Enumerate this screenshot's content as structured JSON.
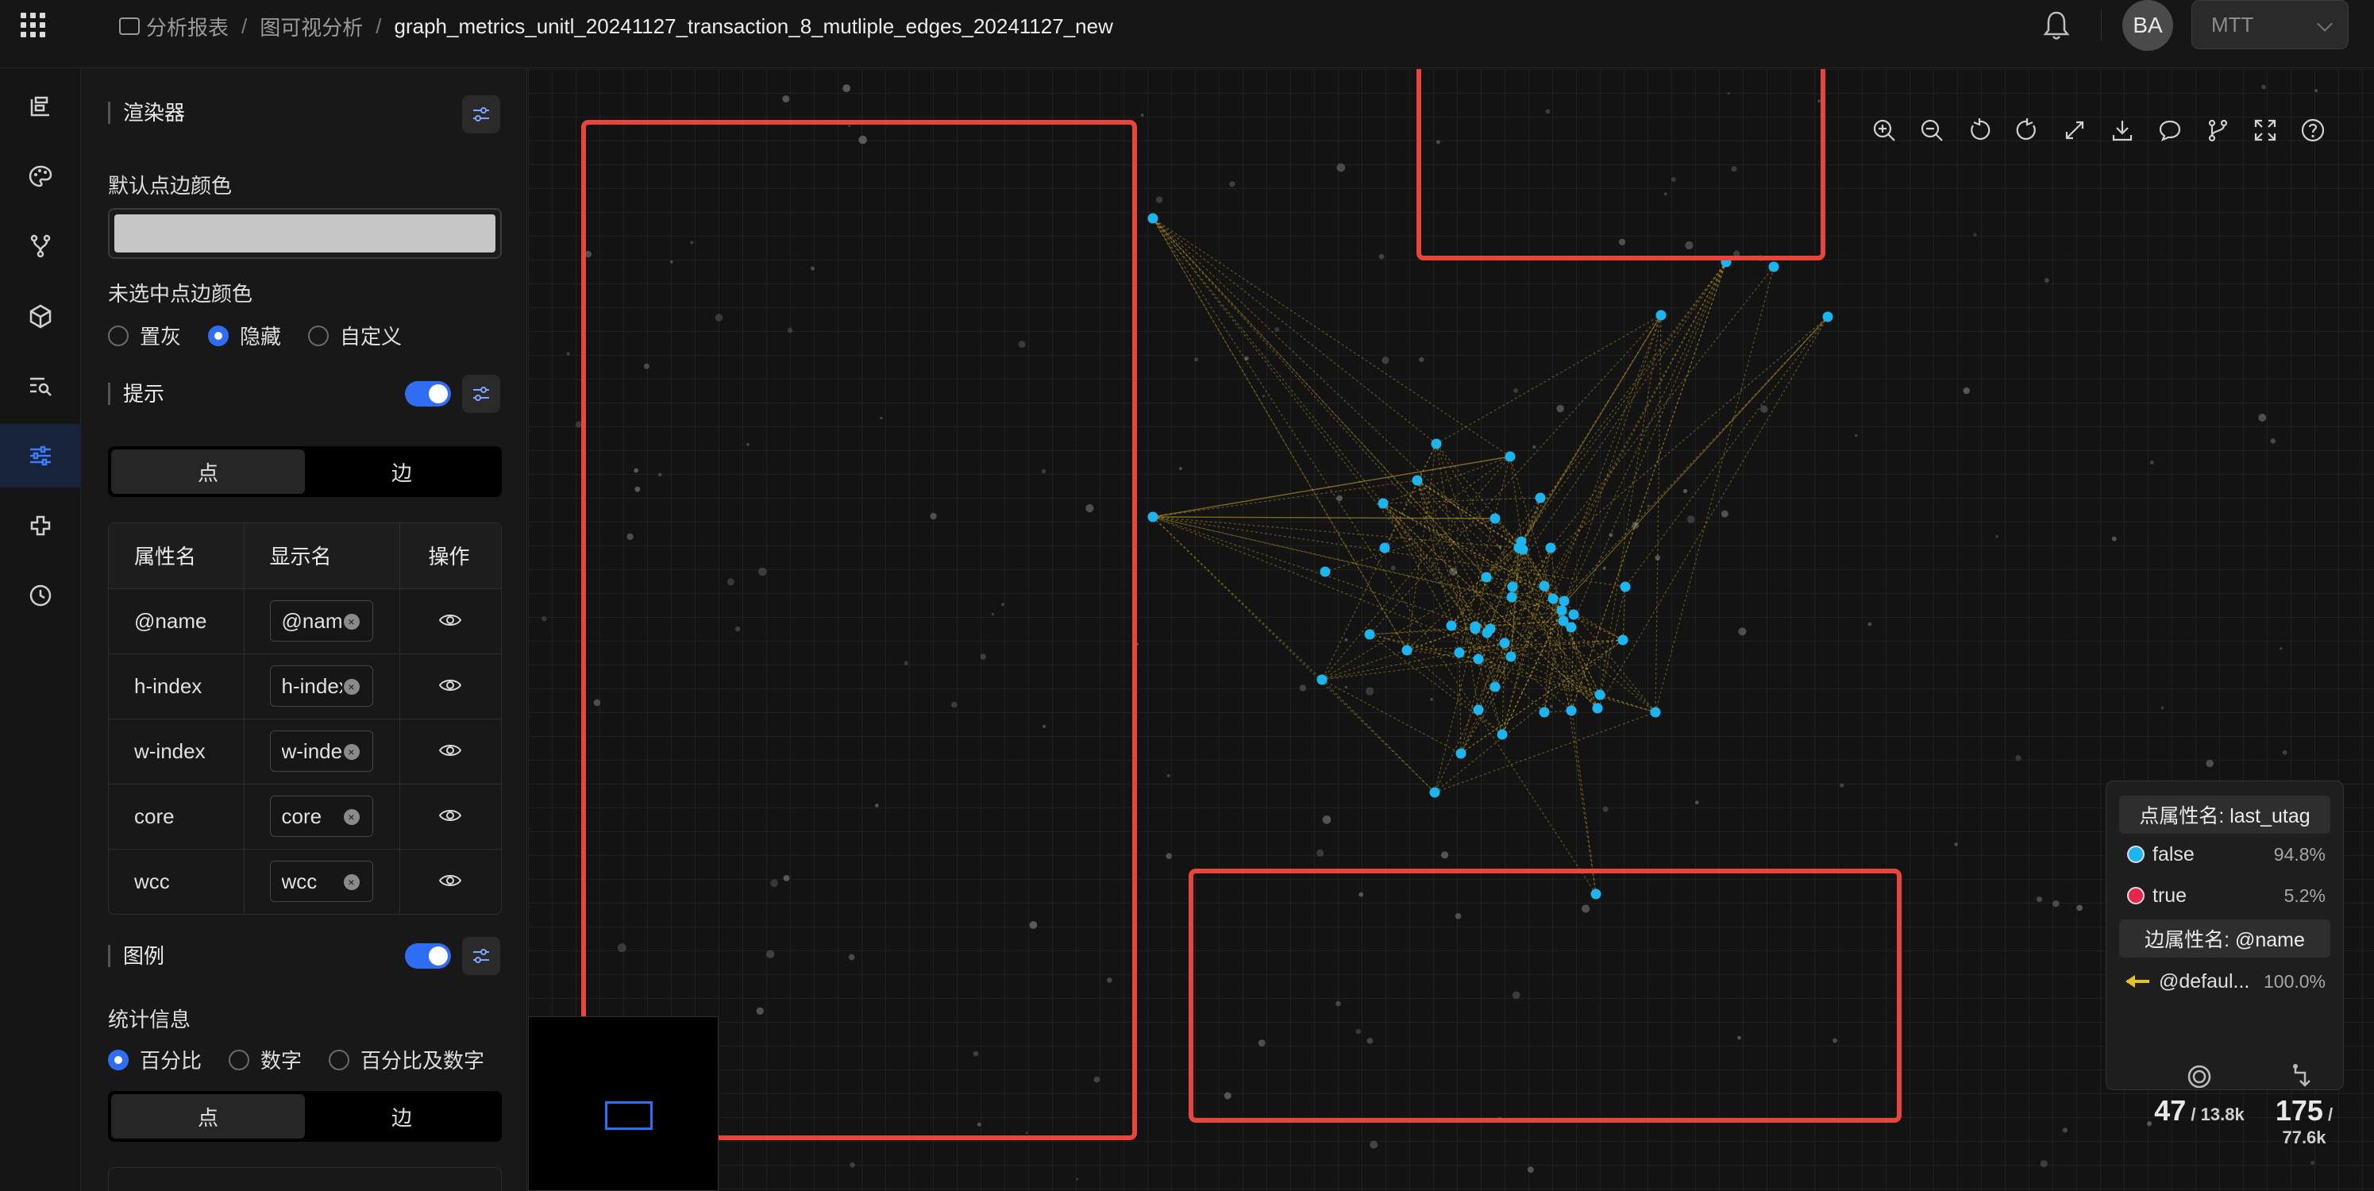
{
  "breadcrumb": {
    "items": [
      "分析报表",
      "图可视分析"
    ],
    "current": "graph_metrics_unitl_20241127_transaction_8_mutliple_edges_20241127_new"
  },
  "header": {
    "avatar": "BA",
    "project": "MTT"
  },
  "rail": {
    "icons": [
      "layers-icon",
      "palette-icon",
      "branch-icon",
      "cube-icon",
      "search-list-icon",
      "sliders-icon",
      "plugin-icon",
      "history-icon"
    ],
    "active_index": 5
  },
  "renderer": {
    "title": "渲染器",
    "default_node_border_label": "默认点边颜色",
    "default_node_border_color": "#c6c6c6",
    "unselected_border_label": "未选中点边颜色",
    "unselected_options": [
      "置灰",
      "隐藏",
      "自定义"
    ],
    "unselected_selected": 1
  },
  "tooltip": {
    "title": "提示",
    "enabled": true,
    "tabs": [
      "点",
      "边"
    ],
    "columns": [
      "属性名",
      "显示名",
      "操作"
    ],
    "rows": [
      {
        "name": "@name",
        "display": "@name"
      },
      {
        "name": "h-index",
        "display": "h-index"
      },
      {
        "name": "w-index",
        "display": "w-index"
      },
      {
        "name": "core",
        "display": "core"
      },
      {
        "name": "wcc",
        "display": "wcc"
      }
    ]
  },
  "legend_settings": {
    "title": "图例",
    "enabled": true,
    "stats_label": "统计信息",
    "stats_options": [
      "百分比",
      "数字",
      "百分比及数字"
    ],
    "stats_selected": 0,
    "tabs": [
      "点",
      "边"
    ]
  },
  "legend": {
    "node_header": "点属性名: last_utag",
    "node_items": [
      {
        "label": "false",
        "pct": "94.8%",
        "color": "#1cb5f0"
      },
      {
        "label": "true",
        "pct": "5.2%",
        "color": "#e8264c"
      }
    ],
    "edge_header": "边属性名: @name",
    "edge_items": [
      {
        "label": "@defaul...",
        "pct": "100.0%",
        "color": "#e6c229"
      }
    ]
  },
  "stats": {
    "nodes_shown": "47",
    "nodes_total": "13.8k",
    "edges_shown": "175",
    "edges_total": "77.6k"
  },
  "toolbar": {
    "icons": [
      "zoom-in-icon",
      "zoom-out-icon",
      "undo-icon",
      "redo-icon",
      "fit-view-icon",
      "download-icon",
      "comment-icon",
      "layout-icon",
      "fullscreen-icon",
      "help-icon"
    ]
  },
  "colors": {
    "accent": "#2f6df3",
    "node": "#1cb5f0",
    "edge": "#c9a227",
    "highlight_box": "#e8453c"
  }
}
